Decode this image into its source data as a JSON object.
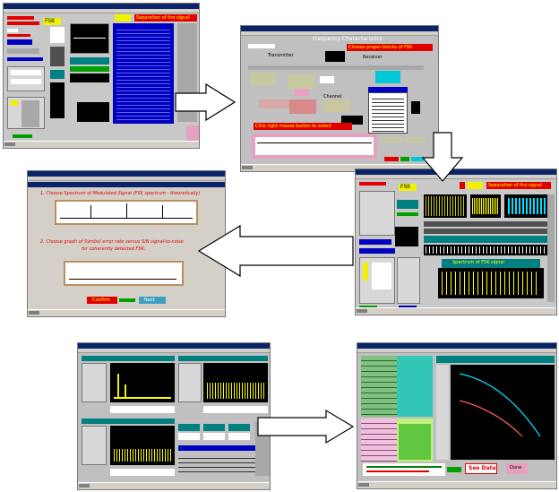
{
  "panels": {
    "p1": {
      "fsk_label": "FSK",
      "banner": "Separation of the signal"
    },
    "p2": {
      "title": "Frequency Characteristics",
      "chain_label": "Channel",
      "receiver_label": "Receiver",
      "transmitter_label": "Transmitter",
      "hint": "Choose proper blocks of FSK",
      "bottom_text": "Click right mouse button to select"
    },
    "p3": {
      "line1": "1. Choose Spectrum of Modulated Signal (FSK spectrum - theoretically)",
      "line2": "2. Choose graph of Symbol error rate versus S/N signal-to-noise",
      "line3": "for coherently detected FSK.",
      "confirm_label": "Confirm",
      "next_label": "Next"
    },
    "p4": {
      "fsk_label": "FSK",
      "banner": "Separation of the signal",
      "wave_title": "Spectrum of FSK signal"
    },
    "p5": {},
    "p6": {
      "button_label": "See Data",
      "small_label": "Done"
    }
  },
  "colors": {
    "red": "#e00000",
    "blue": "#0000c0",
    "yellow": "#f0f000",
    "teal": "#008080",
    "pink": "#e8a0c0"
  }
}
